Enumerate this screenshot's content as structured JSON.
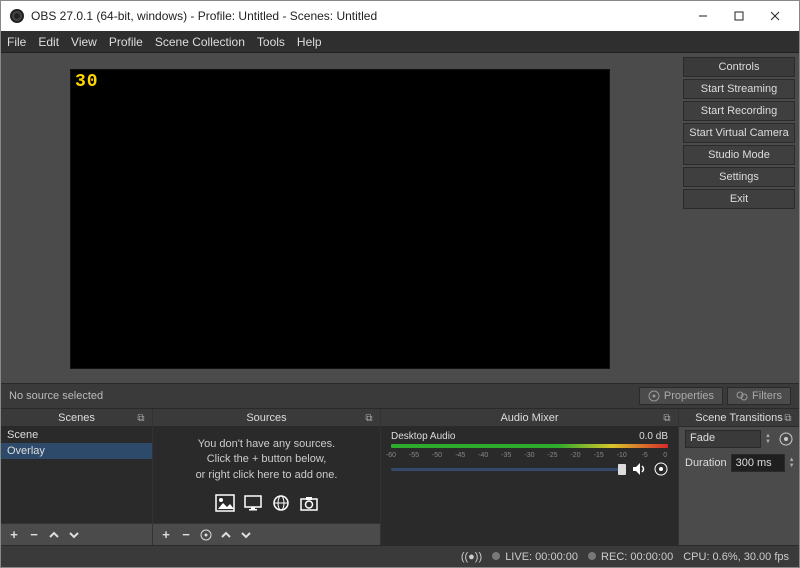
{
  "titlebar": {
    "title": "OBS 27.0.1 (64-bit, windows) - Profile: Untitled - Scenes: Untitled"
  },
  "menubar": {
    "file": "File",
    "edit": "Edit",
    "view": "View",
    "profile": "Profile",
    "scene_collection": "Scene Collection",
    "tools": "Tools",
    "help": "Help"
  },
  "preview": {
    "fps_overlay": "30"
  },
  "controls": {
    "header": "Controls",
    "start_streaming": "Start Streaming",
    "start_recording": "Start Recording",
    "start_virtual_camera": "Start Virtual Camera",
    "studio_mode": "Studio Mode",
    "settings": "Settings",
    "exit": "Exit"
  },
  "sourcebar": {
    "no_source": "No source selected",
    "properties": "Properties",
    "filters": "Filters"
  },
  "panels": {
    "scenes": {
      "title": "Scenes",
      "items": [
        "Scene",
        "Overlay"
      ],
      "selected_index": 1
    },
    "sources": {
      "title": "Sources",
      "empty_line1": "You don't have any sources.",
      "empty_line2": "Click the + button below,",
      "empty_line3": "or right click here to add one."
    },
    "mixer": {
      "title": "Audio Mixer",
      "track_name": "Desktop Audio",
      "track_db": "0.0 dB",
      "ticks": [
        "-60",
        "-55",
        "-50",
        "-45",
        "-40",
        "-35",
        "-30",
        "-25",
        "-20",
        "-15",
        "-10",
        "-5",
        "0"
      ]
    },
    "transitions": {
      "title": "Scene Transitions",
      "selected": "Fade",
      "duration_label": "Duration",
      "duration_value": "300 ms"
    }
  },
  "status": {
    "live_label": "LIVE:",
    "live_time": "00:00:00",
    "rec_label": "REC:",
    "rec_time": "00:00:00",
    "cpu": "CPU: 0.6%, 30.00 fps"
  }
}
